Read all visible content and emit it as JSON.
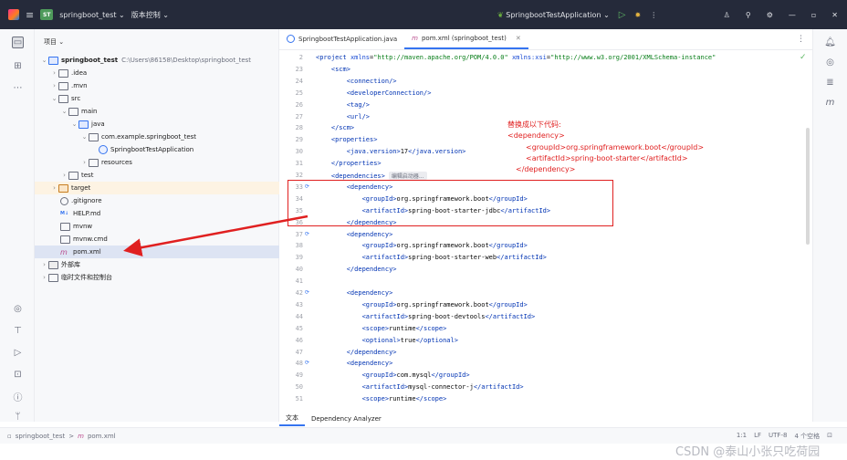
{
  "titlebar": {
    "project_badge": "ST",
    "project_name": "springboot_test",
    "vcs_label": "版本控制",
    "run_config": "SpringbootTestApplication"
  },
  "project_panel": {
    "header": "项目",
    "tree": [
      {
        "label": "springboot_test",
        "path": "C:\\Users\\86158\\Desktop\\springboot_test"
      },
      {
        "label": ".idea"
      },
      {
        "label": ".mvn"
      },
      {
        "label": "src"
      },
      {
        "label": "main"
      },
      {
        "label": "java"
      },
      {
        "label": "com.example.springboot_test"
      },
      {
        "label": "SpringbootTestApplication"
      },
      {
        "label": "resources"
      },
      {
        "label": "test"
      },
      {
        "label": "target"
      },
      {
        "label": ".gitignore"
      },
      {
        "label": "HELP.md"
      },
      {
        "label": "mvnw"
      },
      {
        "label": "mvnw.cmd"
      },
      {
        "label": "pom.xml"
      },
      {
        "label": "外部库"
      },
      {
        "label": "临时文件和控制台"
      }
    ],
    "md_badge": "M↓"
  },
  "editor": {
    "tabs": [
      {
        "label": "SpringbootTestApplication.java"
      },
      {
        "label": "pom.xml (springboot_test)"
      }
    ],
    "lines": [
      {
        "n": "2",
        "tokens": [
          {
            "t": "<project ",
            "c": ""
          },
          {
            "t": "xmlns",
            "c": "attr"
          },
          {
            "t": "=",
            "c": "txt"
          },
          {
            "t": "\"http://maven.apache.org/POM/4.0.0\"",
            "c": "val"
          },
          {
            "t": " xmlns:xsi",
            "c": "attr"
          },
          {
            "t": "=",
            "c": "txt"
          },
          {
            "t": "\"http://www.w3.org/2001/XMLSchema-instance\"",
            "c": "val"
          }
        ]
      },
      {
        "n": "23",
        "tokens": [
          {
            "t": "    <scm>",
            "c": ""
          }
        ]
      },
      {
        "n": "24",
        "tokens": [
          {
            "t": "        <connection/>",
            "c": ""
          }
        ]
      },
      {
        "n": "25",
        "tokens": [
          {
            "t": "        <developerConnection/>",
            "c": ""
          }
        ]
      },
      {
        "n": "26",
        "tokens": [
          {
            "t": "        <tag/>",
            "c": ""
          }
        ]
      },
      {
        "n": "27",
        "tokens": [
          {
            "t": "        <url/>",
            "c": ""
          }
        ]
      },
      {
        "n": "28",
        "tokens": [
          {
            "t": "    </scm>",
            "c": ""
          }
        ]
      },
      {
        "n": "29",
        "tokens": [
          {
            "t": "    <properties>",
            "c": ""
          }
        ]
      },
      {
        "n": "30",
        "tokens": [
          {
            "t": "        <java.version>",
            "c": ""
          },
          {
            "t": "17",
            "c": "txt"
          },
          {
            "t": "</java.version>",
            "c": ""
          }
        ]
      },
      {
        "n": "31",
        "tokens": [
          {
            "t": "    </properties>",
            "c": ""
          }
        ]
      },
      {
        "n": "32",
        "tokens": [
          {
            "t": "    <dependencies>",
            "c": ""
          }
        ],
        "inlay": "编辑启动器..."
      },
      {
        "n": "33",
        "tokens": [
          {
            "t": "        <dependency>",
            "c": ""
          }
        ],
        "marker": "⟳"
      },
      {
        "n": "34",
        "tokens": [
          {
            "t": "            <groupId>",
            "c": ""
          },
          {
            "t": "org.springframework.boot",
            "c": "txt"
          },
          {
            "t": "</groupId>",
            "c": ""
          }
        ]
      },
      {
        "n": "35",
        "tokens": [
          {
            "t": "            <artifactId>",
            "c": ""
          },
          {
            "t": "spring-boot-starter-jdbc",
            "c": "txt"
          },
          {
            "t": "</artifactId>",
            "c": ""
          }
        ]
      },
      {
        "n": "36",
        "tokens": [
          {
            "t": "        </dependency>",
            "c": ""
          }
        ]
      },
      {
        "n": "37",
        "tokens": [
          {
            "t": "        <dependency>",
            "c": ""
          }
        ],
        "marker": "⟳"
      },
      {
        "n": "38",
        "tokens": [
          {
            "t": "            <groupId>",
            "c": ""
          },
          {
            "t": "org.springframework.boot",
            "c": "txt"
          },
          {
            "t": "</groupId>",
            "c": ""
          }
        ]
      },
      {
        "n": "39",
        "tokens": [
          {
            "t": "            <artifactId>",
            "c": ""
          },
          {
            "t": "spring-boot-starter-web",
            "c": "txt"
          },
          {
            "t": "</artifactId>",
            "c": ""
          }
        ]
      },
      {
        "n": "40",
        "tokens": [
          {
            "t": "        </dependency>",
            "c": ""
          }
        ]
      },
      {
        "n": "41",
        "tokens": []
      },
      {
        "n": "42",
        "tokens": [
          {
            "t": "        <dependency>",
            "c": ""
          }
        ],
        "marker": "⟳"
      },
      {
        "n": "43",
        "tokens": [
          {
            "t": "            <groupId>",
            "c": ""
          },
          {
            "t": "org.springframework.boot",
            "c": "txt"
          },
          {
            "t": "</groupId>",
            "c": ""
          }
        ]
      },
      {
        "n": "44",
        "tokens": [
          {
            "t": "            <artifactId>",
            "c": ""
          },
          {
            "t": "spring-boot-devtools",
            "c": "txt"
          },
          {
            "t": "</artifactId>",
            "c": ""
          }
        ]
      },
      {
        "n": "45",
        "tokens": [
          {
            "t": "            <scope>",
            "c": ""
          },
          {
            "t": "runtime",
            "c": "txt"
          },
          {
            "t": "</scope>",
            "c": ""
          }
        ]
      },
      {
        "n": "46",
        "tokens": [
          {
            "t": "            <optional>",
            "c": ""
          },
          {
            "t": "true",
            "c": "txt"
          },
          {
            "t": "</optional>",
            "c": ""
          }
        ]
      },
      {
        "n": "47",
        "tokens": [
          {
            "t": "        </dependency>",
            "c": ""
          }
        ]
      },
      {
        "n": "48",
        "tokens": [
          {
            "t": "        <dependency>",
            "c": ""
          }
        ],
        "marker": "⟳"
      },
      {
        "n": "49",
        "tokens": [
          {
            "t": "            <groupId>",
            "c": ""
          },
          {
            "t": "com.mysql",
            "c": "txt"
          },
          {
            "t": "</groupId>",
            "c": ""
          }
        ]
      },
      {
        "n": "50",
        "tokens": [
          {
            "t": "            <artifactId>",
            "c": ""
          },
          {
            "t": "mysql-connector-j",
            "c": "txt"
          },
          {
            "t": "</artifactId>",
            "c": ""
          }
        ]
      },
      {
        "n": "51",
        "tokens": [
          {
            "t": "            <scope>",
            "c": ""
          },
          {
            "t": "runtime",
            "c": "txt"
          },
          {
            "t": "</scope>",
            "c": ""
          }
        ]
      }
    ]
  },
  "annotation": {
    "heading": "替换成以下代码:",
    "lines": [
      "<dependency>",
      "<groupId>org.springframework.boot</groupId>",
      "<artifactId>spring-boot-starter</artifactId>",
      "</dependency>"
    ],
    "color": "#e02020"
  },
  "bottom_tabs": [
    "文本",
    "Dependency Analyzer"
  ],
  "statusbar": {
    "breadcrumb_project": "springboot_test",
    "breadcrumb_sep": ">",
    "breadcrumb_file": "pom.xml",
    "right": [
      "1:1",
      "LF",
      "UTF-8",
      "4 个空格"
    ]
  },
  "watermark": "CSDN @泰山小张只吃荷园",
  "colors": {
    "accent": "#3574f0",
    "titlebar": "#252a3a",
    "annotation": "#e02020"
  }
}
